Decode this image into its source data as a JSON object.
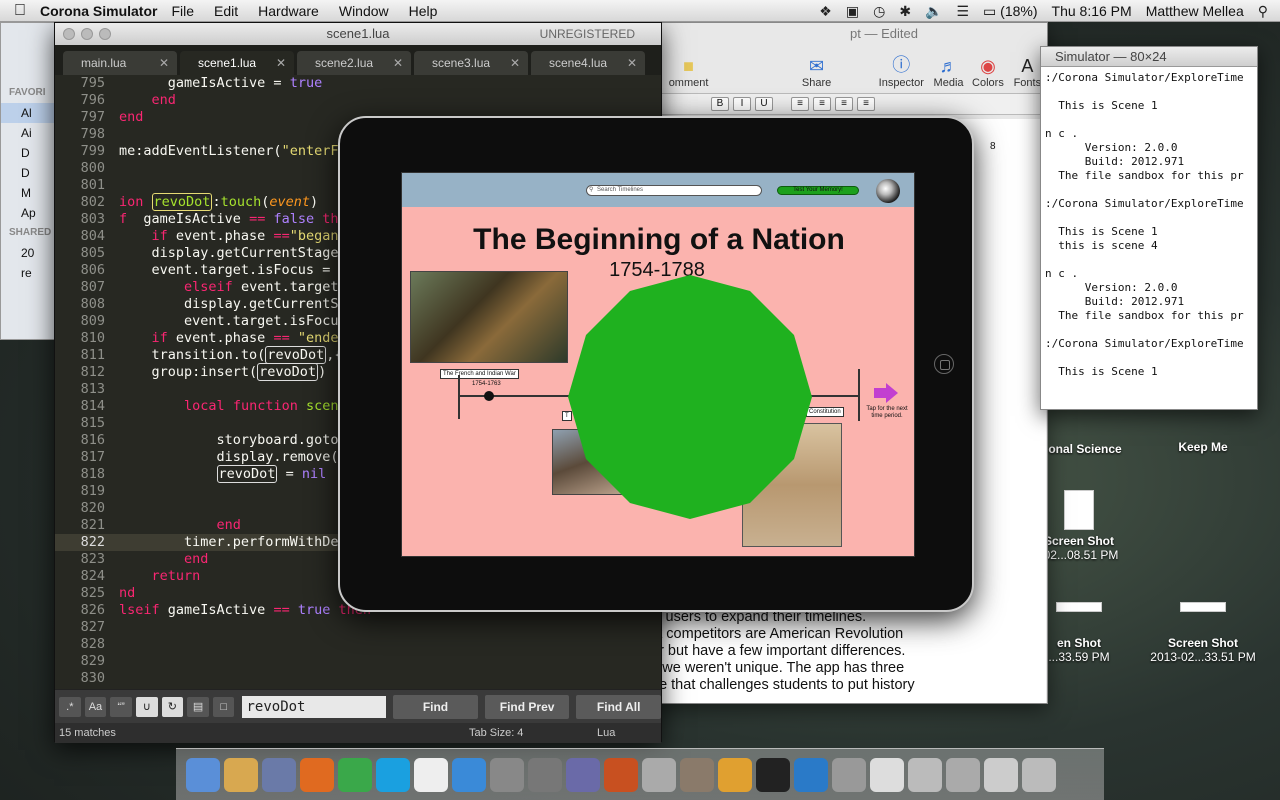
{
  "menubar": {
    "app_name": "Corona Simulator",
    "items": [
      "File",
      "Edit",
      "Hardware",
      "Window",
      "Help"
    ],
    "battery": "(18%)",
    "clock": "Thu 8:16 PM",
    "user": "Matthew Mellea"
  },
  "finder": {
    "section_favorites": "FAVORI",
    "items": [
      "Al",
      "Ai",
      "D",
      "D",
      "M",
      "Ap"
    ],
    "section_shared": "SHARED",
    "shared_items": [
      "20",
      "re"
    ]
  },
  "sublime": {
    "window_title": "scene1.lua",
    "unregistered": "UNREGISTERED",
    "tabs": [
      "main.lua",
      "scene1.lua",
      "scene2.lua",
      "scene3.lua",
      "scene4.lua"
    ],
    "active_tab": 1,
    "line_numbers": [
      "795",
      "796",
      "797",
      "798",
      "799",
      "800",
      "801",
      "802",
      "803",
      "804",
      "805",
      "806",
      "807",
      "808",
      "809",
      "810",
      "811",
      "812",
      "813",
      "814",
      "815",
      "816",
      "817",
      "818",
      "819",
      "820",
      "821",
      "822",
      "823",
      "824",
      "825",
      "826",
      "827",
      "828",
      "829",
      "830"
    ],
    "find_input": "revoDot",
    "find_button": "Find",
    "find_prev_button": "Find Prev",
    "find_all_button": "Find All",
    "status_matches": "15 matches",
    "status_tabsize": "Tab Size: 4",
    "status_lang": "Lua"
  },
  "pages": {
    "title": "pt — Edited",
    "toolbar": [
      "omment",
      "Share",
      "Inspector",
      "Media",
      "Colors",
      "Fonts"
    ],
    "ruler_mark": "8",
    "doc_lines": [
      "w users to expand their timelines.",
      "st competitors are American Revolution",
      "ar but have a few important differences.",
      " if we weren't unique. The app has three",
      "ne that challenges students to put history"
    ]
  },
  "terminal": {
    "title": "Simulator — 80×24",
    "lines": [
      ":/Corona Simulator/ExploreTime",
      "",
      "  This is Scene 1",
      "",
      "n c .",
      "      Version: 2.0.0",
      "      Build: 2012.971",
      "  The file sandbox for this pr",
      "",
      ":/Corona Simulator/ExploreTime",
      "",
      "  This is Scene 1",
      "  this is scene 4",
      "",
      "n c .",
      "      Version: 2.0.0",
      "      Build: 2012.971",
      "  The file sandbox for this pr",
      "",
      ":/Corona Simulator/ExploreTime",
      "",
      "  This is Scene 1"
    ]
  },
  "desktop": {
    "icon1": "onal Science",
    "icon2": "Keep Me",
    "icon3_line1": "Screen Shot",
    "icon3_line2": "-02...08.51 PM",
    "icon4_line1": "en Shot",
    "icon4_line2": "...33.59 PM",
    "icon5_line1": "Screen Shot",
    "icon5_line2": "2013-02...33.51 PM"
  },
  "app": {
    "search_placeholder": "Search Timelines",
    "test_button": "Test Your Memory!",
    "title": "The Beginning of a Nation",
    "years": "1754-1788",
    "label_french_indian": "The French and Indian War",
    "label_french_indian_years": "1754-1763",
    "label_constitution": "Constitution",
    "label_mid": "T",
    "tap_note": "Tap for the next time period.",
    "colors": {
      "background": "#fbb3ae",
      "topbar": "#97b2c6",
      "green_shape": "#1fb11f",
      "arrow": "#c23fd0"
    }
  },
  "dock": {
    "icons": [
      "finder-icon",
      "contacts-icon",
      "mail-icon",
      "firefox-icon",
      "chrome-icon",
      "skype-icon",
      "calendar-icon",
      "itunes-icon",
      "preview-icon",
      "system-prefs-icon",
      "brush-icon",
      "corona-icon",
      "photo-icon",
      "gimp-icon",
      "sublime-icon",
      "terminal-icon",
      "network-icon",
      "utility-icon",
      "document-icon",
      "screen-icon",
      "window-icon",
      "screenshot-icon",
      "trash-icon"
    ]
  }
}
